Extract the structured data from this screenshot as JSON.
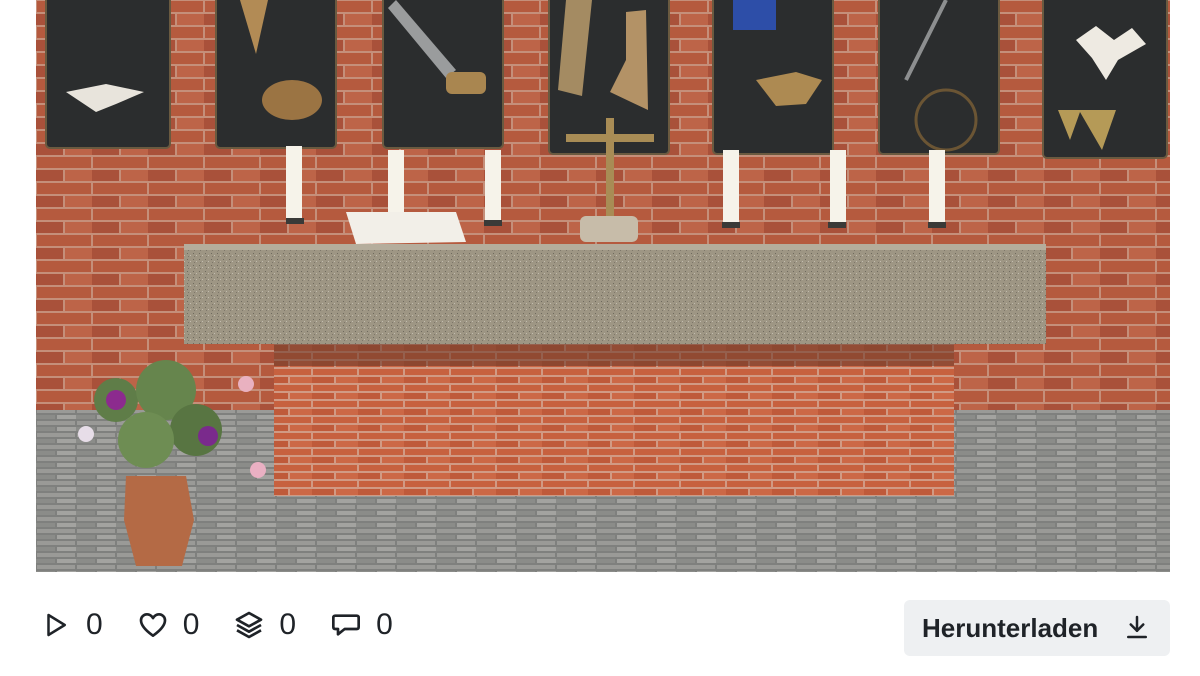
{
  "media": {
    "alt": "",
    "colors": {
      "brick": "#b65b3f",
      "mortar": "#c99a86",
      "panel": "#2a2c2d",
      "stone": "#9c9484",
      "floor": "#8d8e8c"
    }
  },
  "stats": {
    "plays": "0",
    "likes": "0",
    "collections": "0",
    "comments": "0"
  },
  "icons": {
    "plays": "play-icon",
    "likes": "heart-icon",
    "collections": "layers-icon",
    "comments": "comment-icon",
    "download": "download-icon"
  },
  "actions": {
    "download_label": "Herunterladen"
  }
}
